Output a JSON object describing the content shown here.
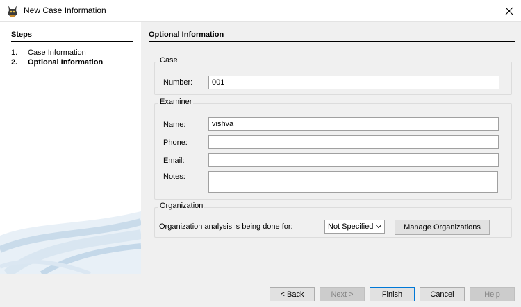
{
  "window": {
    "title": "New Case Information",
    "close_glyph": "✕"
  },
  "steps": {
    "title": "Steps",
    "items": [
      {
        "num": "1.",
        "label": "Case Information"
      },
      {
        "num": "2.",
        "label": "Optional Information"
      }
    ]
  },
  "main": {
    "title": "Optional Information",
    "case": {
      "legend": "Case",
      "number_label": "Number:",
      "number_value": "001"
    },
    "examiner": {
      "legend": "Examiner",
      "name_label": "Name:",
      "name_value": "vishva",
      "phone_label": "Phone:",
      "phone_value": "",
      "email_label": "Email:",
      "email_value": "",
      "notes_label": "Notes:",
      "notes_value": ""
    },
    "organization": {
      "legend": "Organization",
      "analysis_label": "Organization analysis is being done for:",
      "selected": "Not Specified",
      "manage_label": "Manage Organizations"
    }
  },
  "buttons": {
    "back": "< Back",
    "next": "Next >",
    "finish": "Finish",
    "cancel": "Cancel",
    "help": "Help"
  }
}
